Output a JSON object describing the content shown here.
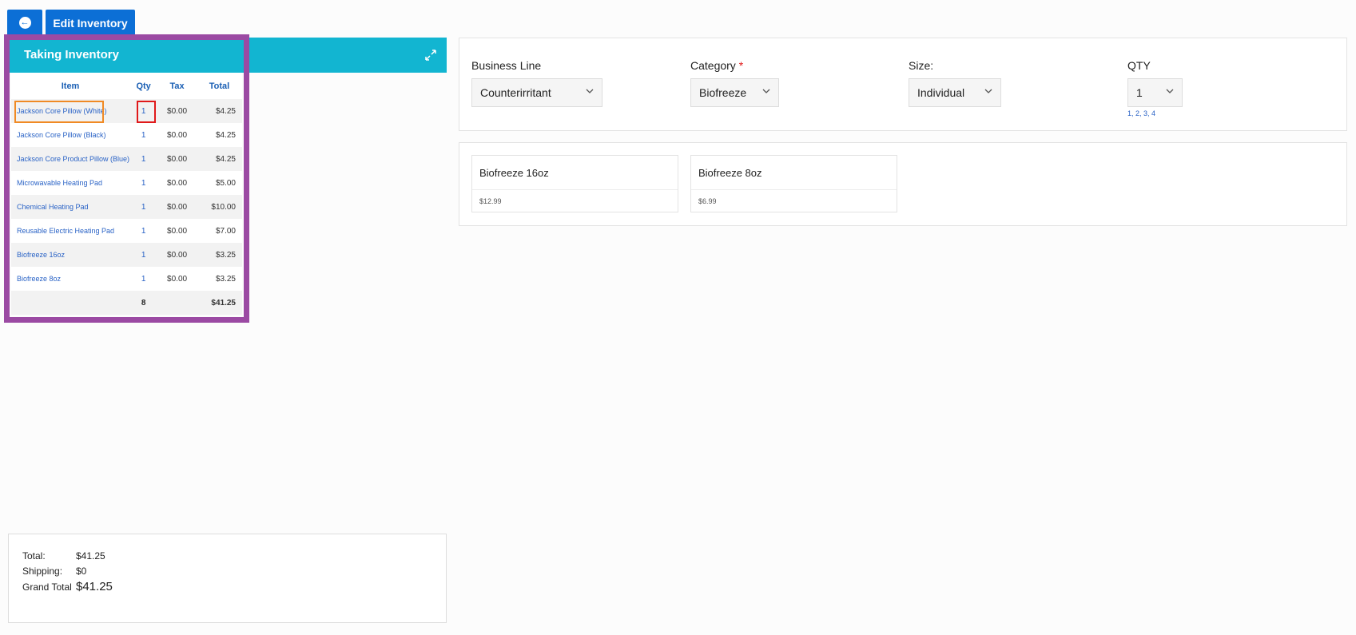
{
  "toolbar": {
    "back_glyph": "←",
    "edit_label": "Edit Inventory"
  },
  "panel": {
    "title": "Taking Inventory"
  },
  "table": {
    "headers": {
      "item": "Item",
      "qty": "Qty",
      "tax": "Tax",
      "total": "Total"
    },
    "rows": [
      {
        "item": "Jackson Core Pillow (White)",
        "qty": "1",
        "tax": "$0.00",
        "total": "$4.25"
      },
      {
        "item": "Jackson Core Pillow (Black)",
        "qty": "1",
        "tax": "$0.00",
        "total": "$4.25"
      },
      {
        "item": "Jackson Core Product Pillow (Blue)",
        "qty": "1",
        "tax": "$0.00",
        "total": "$4.25"
      },
      {
        "item": "Microwavable Heating Pad",
        "qty": "1",
        "tax": "$0.00",
        "total": "$5.00"
      },
      {
        "item": "Chemical Heating Pad",
        "qty": "1",
        "tax": "$0.00",
        "total": "$10.00"
      },
      {
        "item": "Reusable Electric Heating Pad",
        "qty": "1",
        "tax": "$0.00",
        "total": "$7.00"
      },
      {
        "item": "Biofreeze 16oz",
        "qty": "1",
        "tax": "$0.00",
        "total": "$3.25"
      },
      {
        "item": "Biofreeze 8oz",
        "qty": "1",
        "tax": "$0.00",
        "total": "$3.25"
      }
    ],
    "footer": {
      "qty": "8",
      "total": "$41.25"
    }
  },
  "summary": {
    "total_label": "Total:",
    "total_value": "$41.25",
    "shipping_label": "Shipping:",
    "shipping_value": "$0",
    "grand_label": "Grand Total",
    "grand_value": "$41.25"
  },
  "filters": {
    "business_line": {
      "label": "Business Line",
      "value": "Counterirritant"
    },
    "category": {
      "label": "Category",
      "required_mark": "*",
      "value": "Biofreeze"
    },
    "size": {
      "label": "Size:",
      "value": "Individual"
    },
    "qty": {
      "label": "QTY",
      "value": "1",
      "hint": "1, 2, 3, 4"
    }
  },
  "products": [
    {
      "name": "Biofreeze 16oz",
      "price": "$12.99"
    },
    {
      "name": "Biofreeze 8oz",
      "price": "$6.99"
    }
  ],
  "colors": {
    "primary": "#0c6fd6",
    "header": "#12b5d1",
    "link": "#2a63c6",
    "frame": "#9b4aa3"
  },
  "icons": [
    "arrow-left-circle-icon",
    "expand-icon",
    "chevron-down-icon"
  ]
}
